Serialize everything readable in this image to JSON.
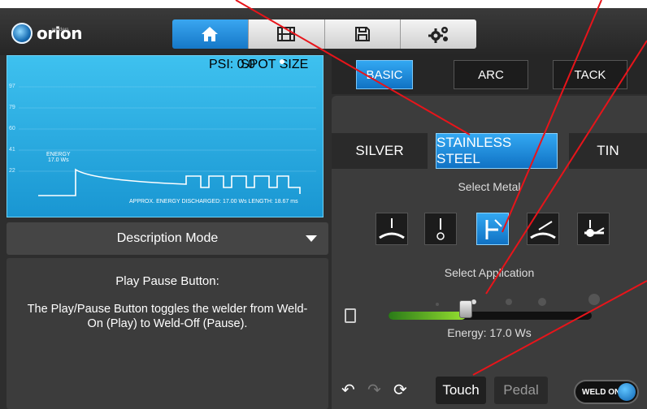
{
  "brand": {
    "name": "orion",
    "sub": "welders"
  },
  "nav": {
    "tabs": [
      {
        "icon": "home-icon",
        "active": true
      },
      {
        "icon": "film-icon",
        "active": false
      },
      {
        "icon": "save-icon",
        "active": false
      },
      {
        "icon": "settings-gears-icon",
        "active": false
      }
    ]
  },
  "graph": {
    "psi": "PSI: 0.0",
    "spot_size": "SPOT SIZE",
    "y_ticks": [
      "97",
      "79",
      "60",
      "41",
      "22"
    ],
    "energy_label": "ENERGY",
    "energy_value": "17.0 Ws",
    "approx": "APPROX. ENERGY DISCHARGED: 17.00  Ws  LENGTH: 18.67 ms"
  },
  "description": {
    "mode_label": "Description Mode",
    "title": "Play Pause Button:",
    "text": "The Play/Pause Button toggles the welder from Weld-On (Play) to Weld-Off (Pause)."
  },
  "modes": {
    "items": [
      "BASIC",
      "ARC",
      "TACK"
    ],
    "active": "BASIC"
  },
  "metals": {
    "items": [
      "SILVER",
      "STAINLESS STEEL",
      "TIN"
    ],
    "active": "STAINLESS STEEL",
    "label": "Select Metal"
  },
  "applications": {
    "label": "Select Application",
    "icons": [
      "flat-butt-application-icon",
      "wire-application-icon",
      "corner-application-icon",
      "angled-application-icon",
      "crossed-wire-application-icon"
    ],
    "active_index": 2
  },
  "energy": {
    "label": "Energy: 17.0 Ws",
    "fraction": 0.38
  },
  "trigger": {
    "touch": "Touch",
    "pedal": "Pedal",
    "active": "Touch"
  },
  "weld_toggle": {
    "label": "WELD ON"
  },
  "colors": {
    "accent": "#1e88d6",
    "annotation": "#e8141a",
    "slider_green": "#96e030"
  }
}
